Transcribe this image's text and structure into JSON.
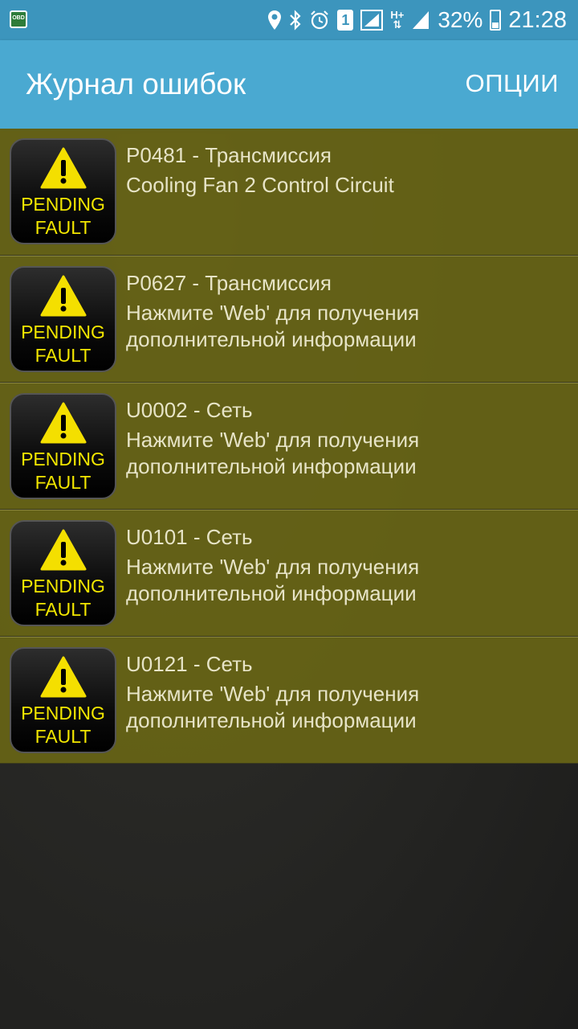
{
  "status_bar": {
    "app_icon": "obd-icon",
    "obd_label": "OBD",
    "icons": [
      "location-icon",
      "bluetooth-icon",
      "alarm-icon",
      "sim-icon",
      "signal-icon",
      "hplus-icon",
      "signal-icon",
      "battery-icon"
    ],
    "sim_number": "1",
    "network_label": "H+",
    "battery_percent": "32%",
    "time": "21:28"
  },
  "app_bar": {
    "title": "Журнал ошибок",
    "options_label": "ОПЦИИ",
    "color": "#4aa9d1"
  },
  "faults": [
    {
      "badge_line1": "PENDING",
      "badge_line2": "FAULT",
      "code": "P0481 - Трансмиссия",
      "desc_line1": "Cooling Fan 2 Control Circuit",
      "desc_line2": ""
    },
    {
      "badge_line1": "PENDING",
      "badge_line2": "FAULT",
      "code": "P0627 - Трансмиссия",
      "desc_line1": "Нажмите 'Web' для получения",
      "desc_line2": "дополнительной информации"
    },
    {
      "badge_line1": "PENDING",
      "badge_line2": "FAULT",
      "code": "U0002 - Сеть",
      "desc_line1": "Нажмите 'Web' для получения",
      "desc_line2": "дополнительной информации"
    },
    {
      "badge_line1": "PENDING",
      "badge_line2": "FAULT",
      "code": "U0101 - Сеть",
      "desc_line1": "Нажмите 'Web' для получения",
      "desc_line2": "дополнительной информации"
    },
    {
      "badge_line1": "PENDING",
      "badge_line2": "FAULT",
      "code": "U0121 - Сеть",
      "desc_line1": "Нажмите 'Web' для получения",
      "desc_line2": "дополнительной информации"
    }
  ],
  "colors": {
    "row_background": "#676416",
    "badge_text": "#f2e600",
    "warning_triangle": "#f4df00"
  }
}
